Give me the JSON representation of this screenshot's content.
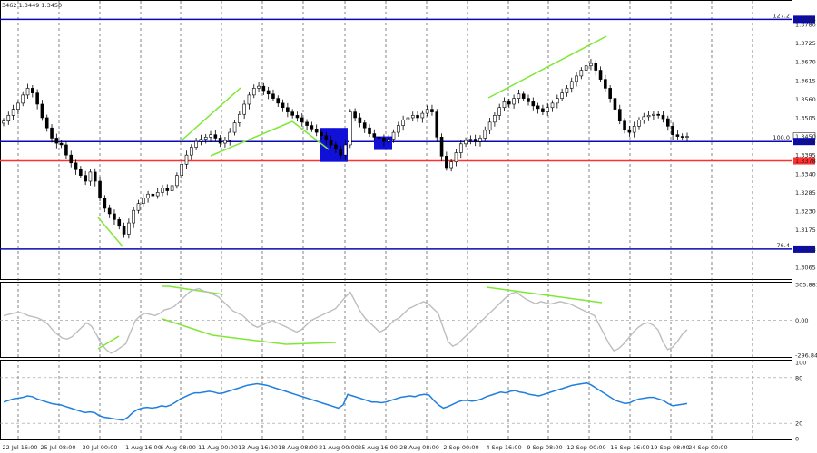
{
  "info": {
    "ohlc_text": "3462 1.3449 1.3450"
  },
  "colors": {
    "hline": "#0a0ab4",
    "redline": "#ff3030",
    "trend": "#7ee835",
    "cci": "#bdbdbd",
    "rsi": "#1f7fe0",
    "box": "#1010d8",
    "candle": "#000000"
  },
  "chart_data": [
    {
      "type": "candlestick",
      "ylim": [
        1.3035,
        1.382
      ],
      "y_tick_labels": [
        "1.3795",
        "1.3780",
        "1.3725",
        "1.3670",
        "1.3615",
        "1.3560",
        "1.3505",
        "1.3450",
        "1.3435",
        "1.3395",
        "1.3378",
        "1.3340",
        "1.3285",
        "1.3230",
        "1.3175",
        "1.3118",
        "1.3065"
      ],
      "x_tick_labels": [
        "22 Jul 16:00",
        "25 Jul 08:00",
        "30 Jul 00:00",
        "1 Aug 16:00",
        "6 Aug 08:00",
        "11 Aug 00:00",
        "13 Aug 16:00",
        "18 Aug 08:00",
        "21 Aug 00:00",
        "25 Aug 16:00",
        "28 Aug 08:00",
        "2 Sep 00:00",
        "4 Sep 16:00",
        "9 Sep 08:00",
        "12 Sep 00:00",
        "16 Sep 16:00",
        "19 Sep 08:00",
        "24 Sep 00:00"
      ],
      "closes": [
        1.3495,
        1.3512,
        1.353,
        1.3548,
        1.3572,
        1.3592,
        1.3578,
        1.3545,
        1.3505,
        1.3475,
        1.3445,
        1.343,
        1.3425,
        1.3395,
        1.3372,
        1.3352,
        1.3335,
        1.3318,
        1.3345,
        1.3318,
        1.3268,
        1.3238,
        1.3222,
        1.3205,
        1.3185,
        1.3162,
        1.3195,
        1.3232,
        1.3252,
        1.3268,
        1.328,
        1.3275,
        1.3285,
        1.3298,
        1.329,
        1.3305,
        1.3335,
        1.3368,
        1.3395,
        1.3418,
        1.3435,
        1.3442,
        1.3448,
        1.3455,
        1.3445,
        1.343,
        1.3438,
        1.3462,
        1.349,
        1.3515,
        1.3545,
        1.3572,
        1.3592,
        1.3598,
        1.3585,
        1.3575,
        1.3562,
        1.3548,
        1.3535,
        1.3522,
        1.3512,
        1.3505,
        1.3492,
        1.3482,
        1.3472,
        1.3462,
        1.3452,
        1.344,
        1.3425,
        1.3412,
        1.3395,
        1.3425,
        1.3522,
        1.3505,
        1.349,
        1.3475,
        1.3458,
        1.3448,
        1.3445,
        1.3435,
        1.3442,
        1.3462,
        1.3482,
        1.3498,
        1.3505,
        1.3512,
        1.3505,
        1.3518,
        1.353,
        1.3522,
        1.3448,
        1.3392,
        1.3358,
        1.3375,
        1.3402,
        1.3428,
        1.3438,
        1.3442,
        1.3435,
        1.3445,
        1.3468,
        1.3492,
        1.3512,
        1.3535,
        1.3552,
        1.3545,
        1.3562,
        1.3575,
        1.3562,
        1.3552,
        1.354,
        1.3532,
        1.3522,
        1.3535,
        1.3548,
        1.3562,
        1.3578,
        1.3592,
        1.3612,
        1.3628,
        1.3645,
        1.3658,
        1.3665,
        1.3645,
        1.3618,
        1.3592,
        1.3562,
        1.353,
        1.3495,
        1.347,
        1.3462,
        1.348,
        1.3498,
        1.3508,
        1.3512,
        1.3515,
        1.3512,
        1.3502,
        1.348,
        1.3455,
        1.345,
        1.3449,
        1.345
      ],
      "horizontal_levels": [
        {
          "label": "127.2",
          "value": 1.3795
        },
        {
          "label": "100.0",
          "value": 1.3435
        },
        {
          "label": "",
          "value": 1.3378
        },
        {
          "label": "76.4",
          "value": 1.3118
        }
      ],
      "price_labels": [
        "1.3795",
        "1.3450",
        "1.3435",
        "1.3378",
        "1.3118"
      ]
    },
    {
      "type": "line",
      "name": "CCI",
      "y_tick_labels": [
        "305.8816",
        "0.00",
        "-296.8474"
      ],
      "values": [
        40,
        50,
        60,
        70,
        60,
        40,
        30,
        20,
        0,
        -30,
        -80,
        -120,
        -150,
        -160,
        -140,
        -100,
        -60,
        -20,
        -50,
        -120,
        -200,
        -250,
        -280,
        -260,
        -230,
        -200,
        -100,
        0,
        40,
        60,
        50,
        40,
        60,
        90,
        100,
        120,
        160,
        200,
        240,
        260,
        270,
        250,
        240,
        220,
        200,
        160,
        120,
        80,
        60,
        40,
        0,
        -40,
        -60,
        -40,
        -20,
        0,
        -20,
        -40,
        -60,
        -80,
        -100,
        -80,
        -40,
        0,
        20,
        40,
        60,
        80,
        100,
        150,
        200,
        240,
        160,
        80,
        20,
        -20,
        -60,
        -100,
        -80,
        -40,
        0,
        20,
        60,
        100,
        120,
        140,
        160,
        140,
        100,
        60,
        -60,
        -180,
        -220,
        -200,
        -160,
        -120,
        -80,
        -40,
        0,
        40,
        80,
        120,
        160,
        200,
        230,
        240,
        210,
        180,
        160,
        140,
        160,
        150,
        140,
        150,
        160,
        150,
        140,
        120,
        100,
        80,
        60,
        40,
        -40,
        -120,
        -200,
        -260,
        -240,
        -200,
        -150,
        -100,
        -60,
        -30,
        -20,
        -40,
        -80,
        -180,
        -250,
        -230,
        -180,
        -120,
        -80
      ]
    },
    {
      "type": "line",
      "name": "RSI",
      "y_tick_labels": [
        "100",
        "80",
        "20",
        "0"
      ],
      "values": [
        48,
        50,
        52,
        53,
        54,
        56,
        55,
        52,
        50,
        48,
        46,
        45,
        44,
        42,
        40,
        38,
        36,
        34,
        35,
        34,
        30,
        28,
        27,
        26,
        25,
        24,
        28,
        34,
        38,
        40,
        41,
        40,
        41,
        43,
        42,
        44,
        48,
        52,
        55,
        58,
        60,
        60,
        61,
        62,
        61,
        59,
        60,
        62,
        64,
        66,
        68,
        70,
        71,
        72,
        71,
        70,
        68,
        66,
        64,
        62,
        60,
        58,
        56,
        54,
        52,
        50,
        48,
        46,
        44,
        42,
        40,
        44,
        58,
        56,
        54,
        52,
        50,
        48,
        48,
        47,
        48,
        50,
        52,
        54,
        55,
        56,
        55,
        57,
        58,
        57,
        50,
        44,
        40,
        42,
        45,
        48,
        50,
        50,
        49,
        50,
        52,
        55,
        57,
        59,
        61,
        60,
        62,
        63,
        61,
        60,
        58,
        57,
        56,
        58,
        60,
        62,
        64,
        66,
        68,
        70,
        71,
        72,
        73,
        70,
        66,
        62,
        58,
        54,
        50,
        48,
        46,
        47,
        50,
        52,
        53,
        54,
        54,
        52,
        50,
        46,
        43,
        44,
        45,
        46
      ]
    }
  ]
}
